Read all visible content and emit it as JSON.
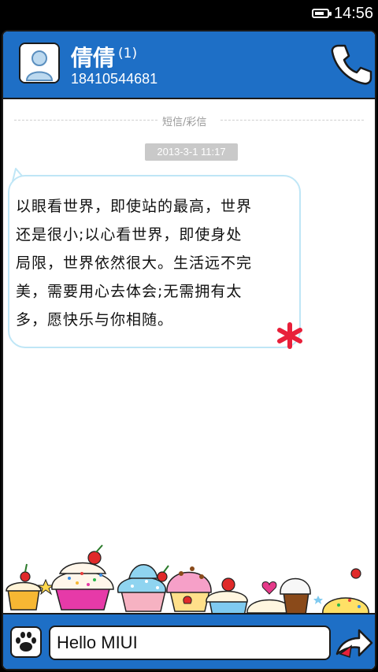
{
  "status_bar": {
    "time": "14:56",
    "battery_level": 0.8
  },
  "header": {
    "contact_name": "倩倩",
    "unread_count": "(1)",
    "phone_number": "18410544681",
    "avatar_icon": "person-silhouette-icon",
    "call_icon": "phone-handset-icon"
  },
  "thread": {
    "message_type": "短信/彩信",
    "timestamp": "2013-3-1 11:17",
    "messages": [
      {
        "lines": [
          "以眼看世界，即使站的最高，世界",
          "还是很小;以心看世界，即使身处",
          "局限，世界依然很大。生活远不完",
          "美，需要用心去体会;无需拥有太",
          "多，愿快乐与你相随。"
        ]
      }
    ]
  },
  "composer": {
    "value": "Hello MIUI",
    "left_icon": "paw-icon",
    "send_icon": "send-arrow-icon"
  },
  "colors": {
    "header_blue": "#1e6fc6",
    "bubble_border": "#bfe6f6",
    "star_red": "#e8203a"
  }
}
